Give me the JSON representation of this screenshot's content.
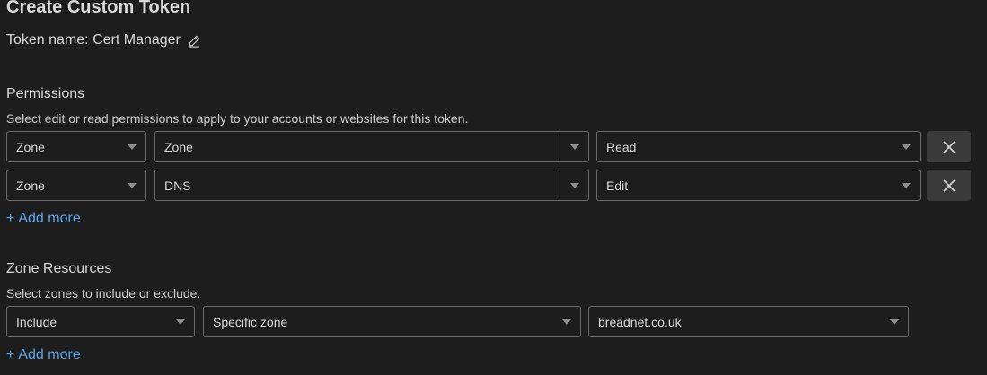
{
  "header": {
    "title": "Create Custom Token",
    "token_name_label": "Token name:",
    "token_name_value": "Cert Manager"
  },
  "permissions": {
    "heading": "Permissions",
    "description": "Select edit or read permissions to apply to your accounts or websites for this token.",
    "rows": [
      {
        "scope": "Zone",
        "resource": "Zone",
        "access": "Read"
      },
      {
        "scope": "Zone",
        "resource": "DNS",
        "access": "Edit"
      }
    ],
    "add_more": "Add more"
  },
  "zone_resources": {
    "heading": "Zone Resources",
    "description": "Select zones to include or exclude.",
    "rows": [
      {
        "mode": "Include",
        "target": "Specific zone",
        "zone": "breadnet.co.uk"
      }
    ],
    "add_more": "Add more"
  },
  "icons": {
    "edit": "pencil-icon",
    "remove": "close-icon",
    "dropdown": "chevron-down-icon",
    "add": "plus-icon"
  },
  "colors": {
    "background": "#1d1d1d",
    "text": "#d9d9d9",
    "link": "#5ea8ee",
    "border": "#6a6a6a",
    "remove_button_bg": "#3a3a3a"
  }
}
